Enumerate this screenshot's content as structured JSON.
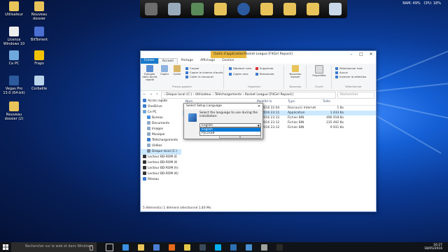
{
  "desktop": {
    "icons": [
      {
        "label": "Utilisateur",
        "name": "user-folder-icon",
        "color": "#e7c35a"
      },
      {
        "label": "Nouveau dossier",
        "name": "new-folder-icon",
        "color": "#e7c35a"
      },
      {
        "label": "Licence Windows 10",
        "name": "document-icon",
        "color": "#eeeeee"
      },
      {
        "label": "BitTorrent",
        "name": "bittorrent-icon",
        "color": "#4a6fd1"
      },
      {
        "label": "Ce PC",
        "name": "computer-icon",
        "color": "#6fa8dc"
      },
      {
        "label": "Fraps",
        "name": "fraps-icon",
        "color": "#f2c200"
      },
      {
        "label": "Vegas Pro 13.0 (64-bit)",
        "name": "vegas-icon",
        "color": "#2c5a9c"
      },
      {
        "label": "Corbeille",
        "name": "recycle-bin-icon",
        "color": "#b9d4ea"
      },
      {
        "label": "Nouveau dossier (2)",
        "name": "new-folder-icon",
        "color": "#e7c35a"
      }
    ]
  },
  "sysmon": {
    "ram": "RAM: 49%",
    "cpu": "CPU: 18%"
  },
  "window": {
    "context_tab": "Outils d'application",
    "title": "Rocket League [FitGirl Repack]",
    "menu": [
      "Fichier",
      "Accueil",
      "Partage",
      "Affichage",
      "Gestion"
    ],
    "ribbon": {
      "pin": "Épingler dans Accès rapide",
      "copy": "Copier",
      "paste": "Coller",
      "cut": "Couper",
      "copy_path": "Copier le chemin d'accès",
      "paste_shortcut": "Coller le raccourci",
      "clipboard_label": "Presse-papiers",
      "move_to": "Déplacer vers",
      "copy_to": "Copier vers",
      "delete": "Supprimer",
      "rename": "Renommer",
      "organize_label": "Organiser",
      "new_folder": "Nouveau dossier",
      "new_label": "Nouveau",
      "properties": "Propriétés",
      "open_label": "Ouvrir",
      "select_all": "Sélectionner tout",
      "select_none": "Aucun",
      "invert": "Inverser la sélection",
      "select_label": "Sélectionner"
    },
    "address": [
      "Disque local (C:)",
      "Utilisateur",
      "Téléchargements",
      "Rocket League [FitGirl Repack]"
    ],
    "search_placeholder": "Rechercher",
    "nav": [
      {
        "label": "Accès rapide",
        "color": "#3c7bd0"
      },
      {
        "label": "OneDrive",
        "color": "#3c7bd0"
      },
      {
        "label": "Ce PC",
        "color": "#6fa8dc"
      },
      {
        "label": "Bureau",
        "color": "#4a90e2"
      },
      {
        "label": "Documents",
        "color": "#8fa9c6"
      },
      {
        "label": "Images",
        "color": "#8fa9c6"
      },
      {
        "label": "Musique",
        "color": "#8fa9c6"
      },
      {
        "label": "Téléchargements",
        "color": "#3c7bd0"
      },
      {
        "label": "Vidéos",
        "color": "#8fa9c6"
      },
      {
        "label": "Disque local (C:)",
        "color": "#7a8a99"
      },
      {
        "label": "Lecteur BD-ROM (E",
        "color": "#333333"
      },
      {
        "label": "Lecteur BD-ROM (K",
        "color": "#333333"
      },
      {
        "label": "Lecteur BD-ROM (h)",
        "color": "#333333"
      },
      {
        "label": "Lecteur BD-ROM (K)",
        "color": "#333333"
      },
      {
        "label": "Réseau",
        "color": "#3c7bd0"
      }
    ],
    "selected_nav": 9,
    "columns": [
      "Nom",
      "Modifié le",
      "Type",
      "Taille"
    ],
    "files": [
      {
        "date": "05/2016 22:04",
        "type": "Raccourci Internet",
        "size": "1 Ko"
      },
      {
        "date": "05/2016 23:11",
        "type": "Application",
        "size": "1 433 Ko"
      },
      {
        "date": "05/2016 23:12",
        "type": "Fichier BIN",
        "size": "496 918 Ko"
      },
      {
        "date": "05/2016 23:12",
        "type": "Fichier BIN",
        "size": "235 492 Ko"
      },
      {
        "date": "05/2016 23:12",
        "type": "Fichier BIN",
        "size": "9 931 Ko"
      }
    ],
    "selected_file": 1,
    "status": "5 élément(s)    1 élément sélectionné  1,40 Mo"
  },
  "dialog": {
    "title": "Select Setup Language",
    "message": "Select the language to use during the installation:",
    "selected": "English",
    "options": [
      "English",
      "Русский"
    ]
  },
  "taskbar": {
    "search_placeholder": "Rechercher sur le web et dans Windows",
    "apps": [
      {
        "name": "task-view-icon",
        "color": "#cccccc"
      },
      {
        "name": "edge-icon",
        "color": "#3a8fe0"
      },
      {
        "name": "file-explorer-icon",
        "color": "#e7c35a"
      },
      {
        "name": "store-icon",
        "color": "#4a7fd6"
      },
      {
        "name": "firefox-icon",
        "color": "#e66a1c"
      },
      {
        "name": "chrome-icon",
        "color": "#e3c84a"
      },
      {
        "name": "steam-icon",
        "color": "#3a4a5c"
      },
      {
        "name": "skype-icon",
        "color": "#00aff0"
      },
      {
        "name": "photoshop-icon",
        "color": "#2f6fb3"
      },
      {
        "name": "vegas-icon",
        "color": "#4a8fd1"
      },
      {
        "name": "winrar-icon",
        "color": "#a0a0a0"
      },
      {
        "name": "setup-icon",
        "color": "#2a2a2a"
      }
    ],
    "time": "16:27",
    "date": "18/05/2016"
  }
}
